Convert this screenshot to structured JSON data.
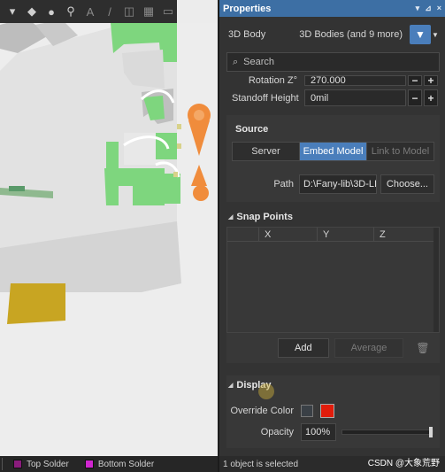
{
  "viewport": {
    "toolbar_icons": [
      "select-icon",
      "move-icon",
      "snap-icon",
      "pin-icon",
      "text-icon",
      "line-icon",
      "dimension-icon",
      "chart-icon",
      "more-icon"
    ],
    "layers": [
      {
        "label": "Top Solder",
        "color": "#8a1c7c"
      },
      {
        "label": "Bottom Solder",
        "color": "#d026d0"
      }
    ],
    "colors": {
      "board": "#e6e6e6",
      "green": "#7ed67e",
      "pad": "#c8a522",
      "marker": "#f08c3c"
    }
  },
  "panel": {
    "title": "Properties",
    "filter_label": "3D Body",
    "filter_value": "3D Bodies (and 9 more)",
    "search_placeholder": "Search",
    "rotation_label": "Rotation Z°",
    "rotation_value": "270.000",
    "standoff_label": "Standoff Height",
    "standoff_value": "0mil",
    "source": {
      "title": "Source",
      "options": [
        "Server",
        "Embed Model",
        "Link to Model"
      ],
      "active": "Embed Model",
      "path_label": "Path",
      "path_value": "D:\\Fany-lib\\3D-LI",
      "choose_label": "Choose..."
    },
    "snap_points": {
      "title": "Snap Points",
      "columns": [
        "X",
        "Y",
        "Z"
      ],
      "add_label": "Add",
      "average_label": "Average"
    },
    "display": {
      "title": "Display",
      "override_label": "Override Color",
      "override_color": "#e21c0b",
      "opacity_label": "Opacity",
      "opacity_value": "100%",
      "opacity_fraction": 1.0
    },
    "status": "1 object is selected"
  },
  "watermark": "CSDN @大象荒野"
}
